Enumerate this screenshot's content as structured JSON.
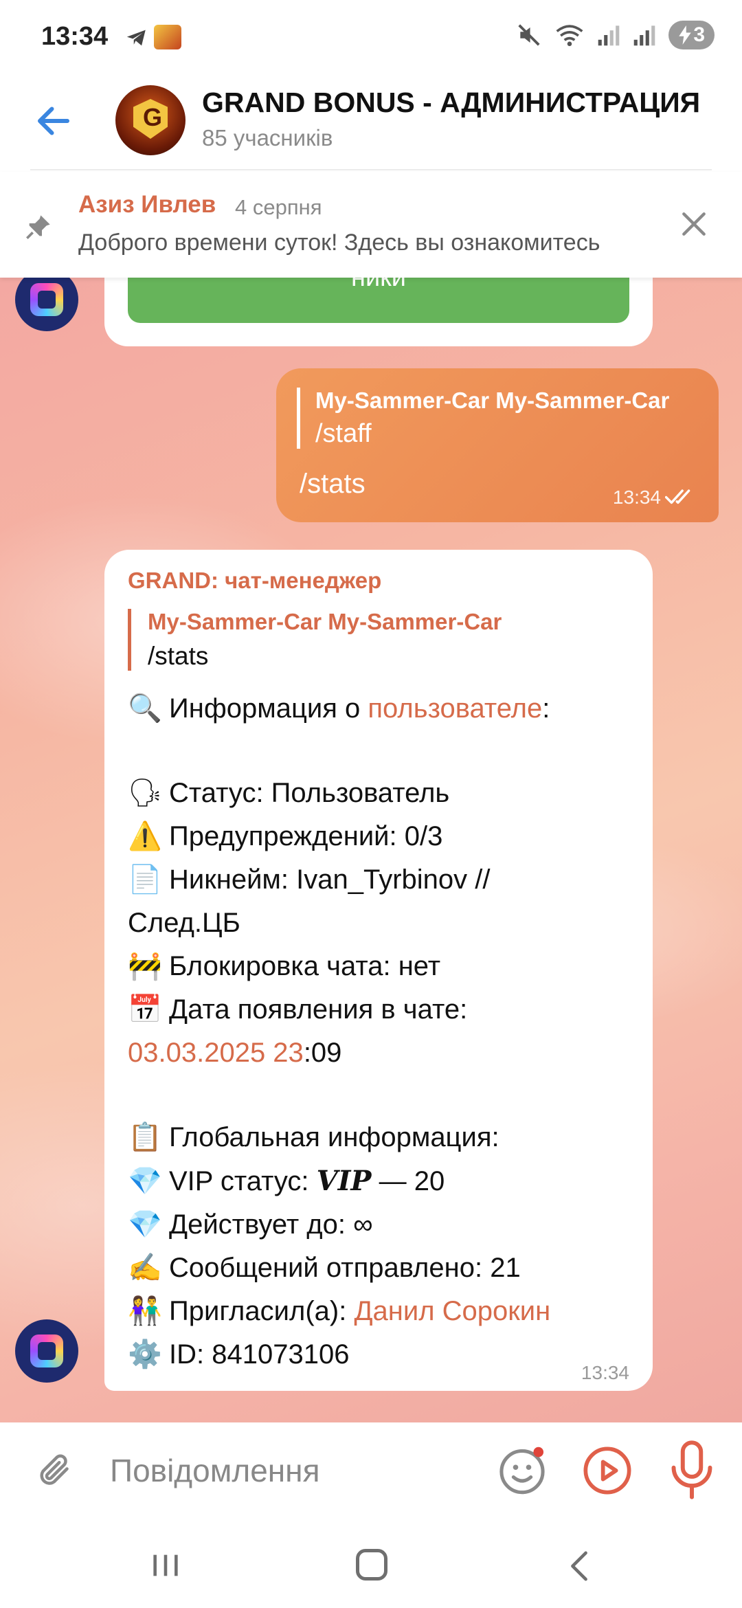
{
  "status_bar": {
    "time": "13:34",
    "battery": "3"
  },
  "header": {
    "title": "GRAND BONUS - АДМИНИСТРАЦИЯ",
    "members": "85 учасників"
  },
  "pinned": {
    "author": "Азиз Ивлев",
    "date": "4 серпня",
    "text": "Доброго времени суток!  Здесь вы ознакомитесь"
  },
  "messages": {
    "top_button_label": "ники",
    "outgoing": {
      "reply_name": "My-Sammer-Car My-Sammer-Car",
      "reply_text": "/staff",
      "text": "/stats",
      "time": "13:34"
    },
    "incoming": {
      "sender": "GRAND: чат-менеджер",
      "reply_name": "My-Sammer-Car My-Sammer-Car",
      "reply_text": "/stats",
      "info_prefix": "Информация о ",
      "info_link": "пользователе",
      "info_suffix": ":",
      "status": "Статус: Пользователь",
      "warnings": "Предупреждений: 0/3",
      "nickname_1": "Никнейм: Ivan_Tyrbinov //",
      "nickname_2": "След.ЦБ",
      "block": "Блокировка чата: нет",
      "join_label": "Дата появления в чате:",
      "join_date_link": "03.03.2025 23",
      "join_date_rest": ":09",
      "global_info": "Глобальная информация:",
      "vip_label": "VIP статус: ",
      "vip_value": "VIP",
      "vip_rest": " — 20",
      "valid_until": "Действует до: ∞",
      "sent": "Сообщений отправлено: 21",
      "invited_label": "Пригласил(а): ",
      "invited_link": "Данил Сорокин",
      "id": "ID: 841073106",
      "time": "13:34"
    }
  },
  "composer": {
    "placeholder": "Повідомлення"
  },
  "colors": {
    "accent": "#d66b4a",
    "outgoing_bubble": "#ea8750",
    "button_green": "#66b45a",
    "back_arrow": "#3a86e0"
  }
}
